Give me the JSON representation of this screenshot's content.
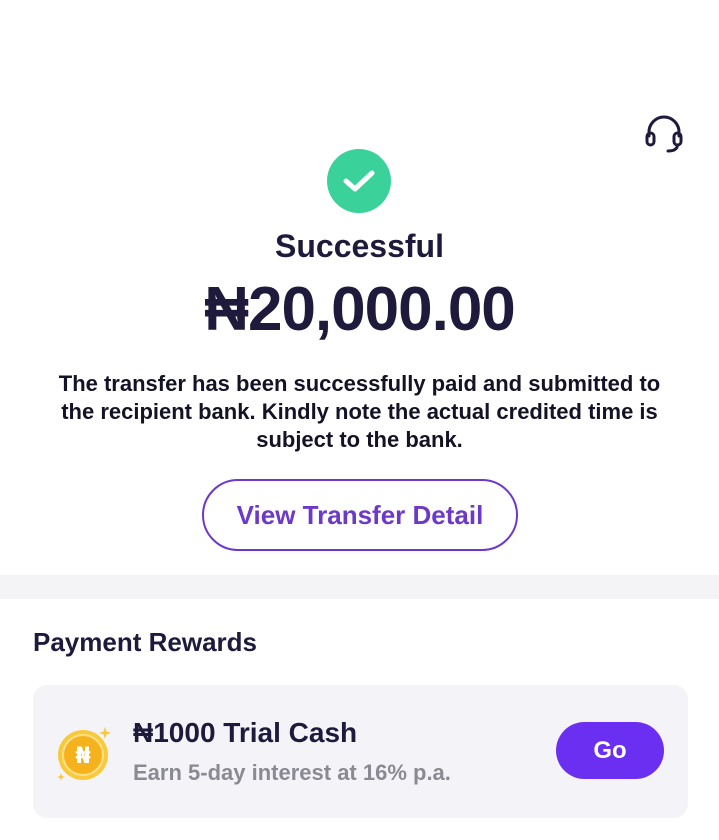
{
  "header": {
    "support_icon": "headset-icon"
  },
  "status": {
    "icon": "check-circle-icon",
    "title": "Successful",
    "amount": "₦20,000.00",
    "message": "The transfer has been successfully paid and submitted to the recipient bank. Kindly note the actual credited time is subject to the bank."
  },
  "actions": {
    "view_detail_label": "View Transfer Detail"
  },
  "rewards": {
    "section_title": "Payment Rewards",
    "items": [
      {
        "icon": "naira-coin-icon",
        "coin_symbol": "₦",
        "title": "₦1000 Trial Cash",
        "subtitle": "Earn 5-day interest at 16% p.a.",
        "button_label": "Go"
      }
    ]
  },
  "colors": {
    "success": "#3ad29a",
    "accent": "#6c39c8",
    "button_primary": "#6a2ff0",
    "coin": "#f6b21c",
    "text_dark": "#1d1a3b",
    "text_muted": "#8a8a93",
    "card_bg": "#f4f4f8"
  }
}
